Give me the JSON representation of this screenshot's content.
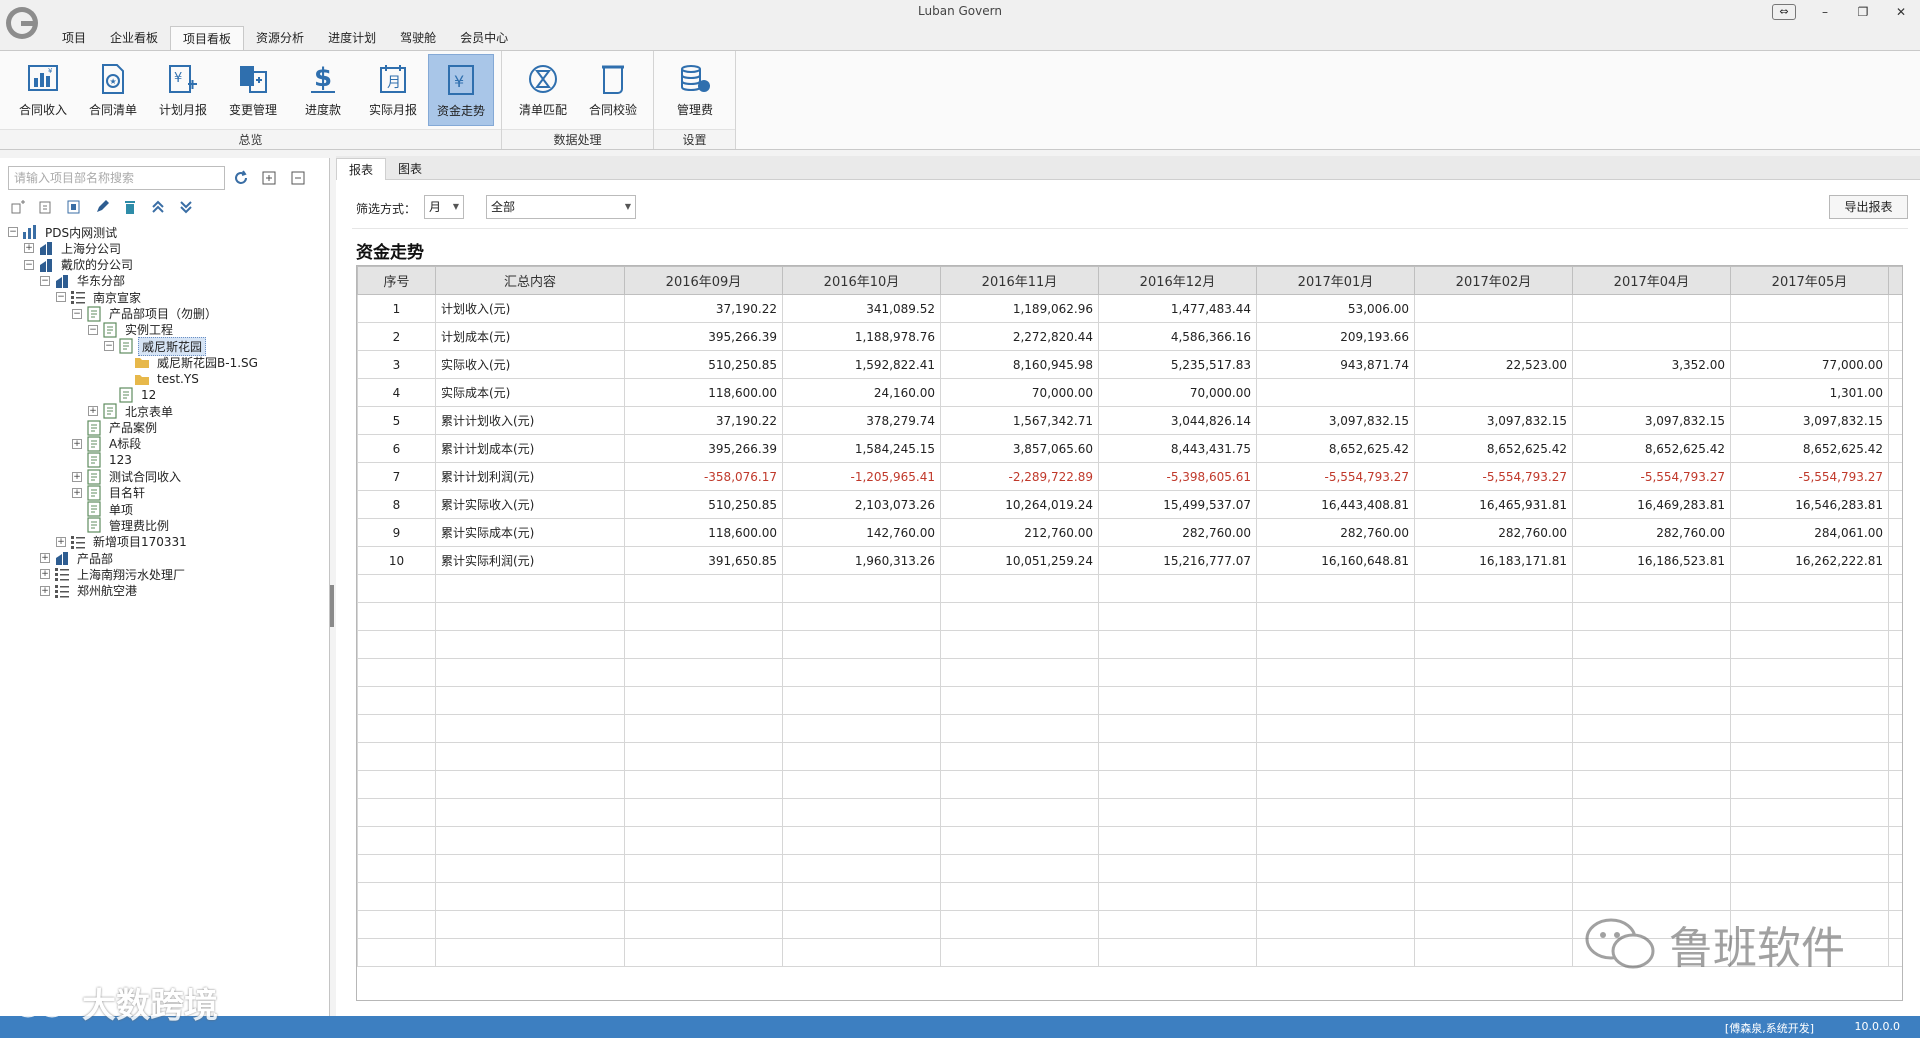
{
  "app": {
    "title": "Luban Govern"
  },
  "menu_tabs": [
    "项目",
    "企业看板",
    "项目看板",
    "资源分析",
    "进度计划",
    "驾驶舱",
    "会员中心"
  ],
  "ribbon": {
    "groups": [
      {
        "label": "总览",
        "buttons": [
          "合同收入",
          "合同清单",
          "计划月报",
          "变更管理",
          "进度款",
          "实际月报",
          "资金走势"
        ]
      },
      {
        "label": "数据处理",
        "buttons": [
          "清单匹配",
          "合同校验"
        ]
      },
      {
        "label": "设置",
        "buttons": [
          "管理费"
        ]
      }
    ],
    "active_button": "资金走势"
  },
  "left": {
    "search_placeholder": "请输入项目部名称搜索",
    "tree": [
      {
        "label": "PDS内网测试",
        "level": 0,
        "exp": "-",
        "icon": "org"
      },
      {
        "label": "上海分公司",
        "level": 1,
        "exp": "+",
        "icon": "company"
      },
      {
        "label": "戴欣的分公司",
        "level": 1,
        "exp": "-",
        "icon": "company"
      },
      {
        "label": "华东分部",
        "level": 2,
        "exp": "-",
        "icon": "company"
      },
      {
        "label": "南京宣家",
        "level": 3,
        "exp": "-",
        "icon": "list"
      },
      {
        "label": "产品部项目（勿删）",
        "level": 4,
        "exp": "-",
        "icon": "project"
      },
      {
        "label": "实例工程",
        "level": 5,
        "exp": "-",
        "icon": "project"
      },
      {
        "label": "威尼斯花园",
        "level": 6,
        "exp": "-",
        "icon": "project",
        "selected": true
      },
      {
        "label": "威尼斯花园B-1.SG",
        "level": 7,
        "exp": "",
        "icon": "folder"
      },
      {
        "label": "test.YS",
        "level": 7,
        "exp": "",
        "icon": "folder"
      },
      {
        "label": "12",
        "level": 6,
        "exp": "",
        "icon": "project"
      },
      {
        "label": "北京表单",
        "level": 5,
        "exp": "+",
        "icon": "project"
      },
      {
        "label": "产品案例",
        "level": 4,
        "exp": "",
        "icon": "project"
      },
      {
        "label": "A标段",
        "level": 4,
        "exp": "+",
        "icon": "project"
      },
      {
        "label": "123",
        "level": 4,
        "exp": "",
        "icon": "project"
      },
      {
        "label": "测试合同收入",
        "level": 4,
        "exp": "+",
        "icon": "project"
      },
      {
        "label": "目名轩",
        "level": 4,
        "exp": "+",
        "icon": "project"
      },
      {
        "label": "单项",
        "level": 4,
        "exp": "",
        "icon": "project"
      },
      {
        "label": "管理费比例",
        "level": 4,
        "exp": "",
        "icon": "project"
      },
      {
        "label": "新增项目170331",
        "level": 3,
        "exp": "+",
        "icon": "list"
      },
      {
        "label": "产品部",
        "level": 2,
        "exp": "+",
        "icon": "company"
      },
      {
        "label": "上海南翔污水处理厂",
        "level": 2,
        "exp": "+",
        "icon": "list"
      },
      {
        "label": "郑州航空港",
        "level": 2,
        "exp": "+",
        "icon": "list"
      }
    ]
  },
  "subtabs": [
    "报表",
    "图表"
  ],
  "filter": {
    "label": "筛选方式：",
    "period": "月",
    "scope": "全部"
  },
  "export_label": "导出报表",
  "report_title": "资金走势",
  "table": {
    "headers": [
      "序号",
      "汇总内容",
      "2016年09月",
      "2016年10月",
      "2016年11月",
      "2016年12月",
      "2017年01月",
      "2017年02月",
      "2017年04月",
      "2017年05月"
    ],
    "rows": [
      [
        "1",
        "计划收入(元)",
        "37,190.22",
        "341,089.52",
        "1,189,062.96",
        "1,477,483.44",
        "53,006.00",
        "",
        "",
        ""
      ],
      [
        "2",
        "计划成本(元)",
        "395,266.39",
        "1,188,978.76",
        "2,272,820.44",
        "4,586,366.16",
        "209,193.66",
        "",
        "",
        ""
      ],
      [
        "3",
        "实际收入(元)",
        "510,250.85",
        "1,592,822.41",
        "8,160,945.98",
        "5,235,517.83",
        "943,871.74",
        "22,523.00",
        "3,352.00",
        "77,000.00"
      ],
      [
        "4",
        "实际成本(元)",
        "118,600.00",
        "24,160.00",
        "70,000.00",
        "70,000.00",
        "",
        "",
        "",
        "1,301.00"
      ],
      [
        "5",
        "累计计划收入(元)",
        "37,190.22",
        "378,279.74",
        "1,567,342.71",
        "3,044,826.14",
        "3,097,832.15",
        "3,097,832.15",
        "3,097,832.15",
        "3,097,832.15"
      ],
      [
        "6",
        "累计计划成本(元)",
        "395,266.39",
        "1,584,245.15",
        "3,857,065.60",
        "8,443,431.75",
        "8,652,625.42",
        "8,652,625.42",
        "8,652,625.42",
        "8,652,625.42"
      ],
      [
        "7",
        "累计计划利润(元)",
        "-358,076.17",
        "-1,205,965.41",
        "-2,289,722.89",
        "-5,398,605.61",
        "-5,554,793.27",
        "-5,554,793.27",
        "-5,554,793.27",
        "-5,554,793.27"
      ],
      [
        "8",
        "累计实际收入(元)",
        "510,250.85",
        "2,103,073.26",
        "10,264,019.24",
        "15,499,537.07",
        "16,443,408.81",
        "16,465,931.81",
        "16,469,283.81",
        "16,546,283.81"
      ],
      [
        "9",
        "累计实际成本(元)",
        "118,600.00",
        "142,760.00",
        "212,760.00",
        "282,760.00",
        "282,760.00",
        "282,760.00",
        "282,760.00",
        "284,061.00"
      ],
      [
        "10",
        "累计实际利润(元)",
        "391,650.85",
        "1,960,313.26",
        "10,051,259.24",
        "15,216,777.07",
        "16,160,648.81",
        "16,183,171.81",
        "16,186,523.81",
        "16,262,222.81"
      ]
    ]
  },
  "status": {
    "user": "[傅森泉,系统开发]",
    "version": "10.0.0.0"
  },
  "watermarks": {
    "left": "大数跨境",
    "right": "鲁班软件"
  },
  "colors": {
    "accent": "#3d7fc1",
    "negative": "#c0392b",
    "active_ribbon": "#a9c6e8"
  }
}
